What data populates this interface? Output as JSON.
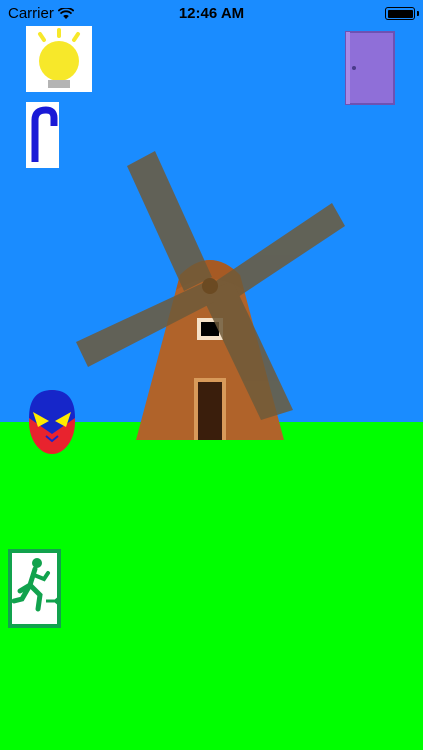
{
  "status_bar": {
    "carrier": "Carrier",
    "time": "12:46 AM",
    "battery_level": 1.0
  },
  "colors": {
    "sky": "#1a8cff",
    "grass": "#00ff00",
    "mill_body": "#b0632a",
    "sails": "#6e5a3a",
    "door": "#8f6fd8"
  },
  "icons": {
    "top_left": "lightbulb-icon",
    "top_right": "door-icon",
    "second_left": "cane-icon",
    "center": "windmill",
    "character": "masked-egg-character",
    "bottom_left": "exit-sign-icon"
  }
}
